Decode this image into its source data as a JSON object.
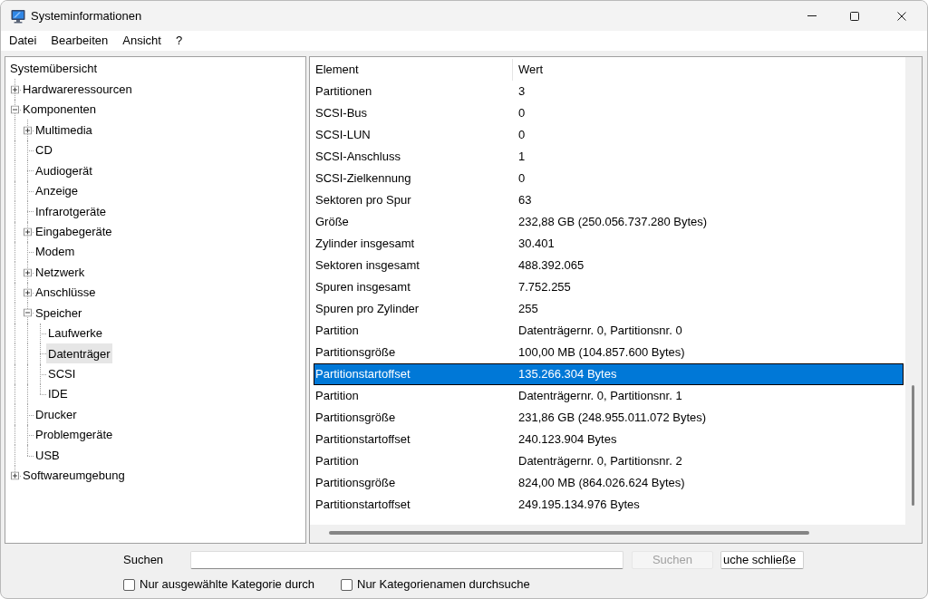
{
  "window": {
    "title": "Systeminformationen"
  },
  "menu": [
    "Datei",
    "Bearbeiten",
    "Ansicht",
    "?"
  ],
  "tree": {
    "items": [
      {
        "label": "Systemübersicht",
        "kind": "root",
        "selected": false,
        "children": [
          {
            "label": "Hardwareressourcen",
            "kind": "branch",
            "expanded": false,
            "selected": false
          },
          {
            "label": "Komponenten",
            "kind": "branch",
            "expanded": true,
            "selected": false,
            "children": [
              {
                "label": "Multimedia",
                "kind": "branch",
                "expanded": false,
                "selected": false
              },
              {
                "label": "CD",
                "kind": "leaf",
                "selected": false
              },
              {
                "label": "Audiogerät",
                "kind": "leaf",
                "selected": false
              },
              {
                "label": "Anzeige",
                "kind": "leaf",
                "selected": false
              },
              {
                "label": "Infrarotgeräte",
                "kind": "leaf",
                "selected": false
              },
              {
                "label": "Eingabegeräte",
                "kind": "branch",
                "expanded": false,
                "selected": false
              },
              {
                "label": "Modem",
                "kind": "leaf",
                "selected": false
              },
              {
                "label": "Netzwerk",
                "kind": "branch",
                "expanded": false,
                "selected": false
              },
              {
                "label": "Anschlüsse",
                "kind": "branch",
                "expanded": false,
                "selected": false
              },
              {
                "label": "Speicher",
                "kind": "branch",
                "expanded": true,
                "selected": false,
                "children": [
                  {
                    "label": "Laufwerke",
                    "kind": "leaf",
                    "selected": false
                  },
                  {
                    "label": "Datenträger",
                    "kind": "leaf",
                    "selected": true
                  },
                  {
                    "label": "SCSI",
                    "kind": "leaf",
                    "selected": false
                  },
                  {
                    "label": "IDE",
                    "kind": "leaf",
                    "selected": false
                  }
                ]
              },
              {
                "label": "Drucker",
                "kind": "leaf",
                "selected": false
              },
              {
                "label": "Problemgeräte",
                "kind": "leaf",
                "selected": false
              },
              {
                "label": "USB",
                "kind": "leaf",
                "selected": false
              }
            ]
          },
          {
            "label": "Softwareumgebung",
            "kind": "branch",
            "expanded": false,
            "selected": false
          }
        ]
      }
    ]
  },
  "table": {
    "columns": [
      "Element",
      "Wert"
    ],
    "rows": [
      {
        "cells": [
          "Partitionen",
          "3"
        ],
        "selected": false
      },
      {
        "cells": [
          "SCSI-Bus",
          "0"
        ],
        "selected": false
      },
      {
        "cells": [
          "SCSI-LUN",
          "0"
        ],
        "selected": false
      },
      {
        "cells": [
          "SCSI-Anschluss",
          "1"
        ],
        "selected": false
      },
      {
        "cells": [
          "SCSI-Zielkennung",
          "0"
        ],
        "selected": false
      },
      {
        "cells": [
          "Sektoren pro Spur",
          "63"
        ],
        "selected": false
      },
      {
        "cells": [
          "Größe",
          "232,88 GB (250.056.737.280 Bytes)"
        ],
        "selected": false
      },
      {
        "cells": [
          "Zylinder insgesamt",
          "30.401"
        ],
        "selected": false
      },
      {
        "cells": [
          "Sektoren insgesamt",
          "488.392.065"
        ],
        "selected": false
      },
      {
        "cells": [
          "Spuren insgesamt",
          "7.752.255"
        ],
        "selected": false
      },
      {
        "cells": [
          "Spuren pro Zylinder",
          "255"
        ],
        "selected": false
      },
      {
        "cells": [
          "Partition",
          "Datenträgernr. 0, Partitionsnr. 0"
        ],
        "selected": false
      },
      {
        "cells": [
          "Partitionsgröße",
          "100,00 MB (104.857.600 Bytes)"
        ],
        "selected": false
      },
      {
        "cells": [
          "Partitionstartoffset",
          "135.266.304 Bytes"
        ],
        "selected": true
      },
      {
        "cells": [
          "Partition",
          "Datenträgernr. 0, Partitionsnr. 1"
        ],
        "selected": false
      },
      {
        "cells": [
          "Partitionsgröße",
          "231,86 GB (248.955.011.072 Bytes)"
        ],
        "selected": false
      },
      {
        "cells": [
          "Partitionstartoffset",
          "240.123.904 Bytes"
        ],
        "selected": false
      },
      {
        "cells": [
          "Partition",
          "Datenträgernr. 0, Partitionsnr. 2"
        ],
        "selected": false
      },
      {
        "cells": [
          "Partitionsgröße",
          "824,00 MB (864.026.624 Bytes)"
        ],
        "selected": false
      },
      {
        "cells": [
          "Partitionstartoffset",
          "249.195.134.976 Bytes"
        ],
        "selected": false
      }
    ]
  },
  "search": {
    "label": "Suchen",
    "buttons": [
      {
        "label": "Suchen",
        "disabled": true
      },
      {
        "label": "uche schließe",
        "disabled": false
      }
    ],
    "options": [
      {
        "label": "Nur ausgewählte Kategorie durch",
        "checked": false
      },
      {
        "label": "Nur Kategorienamen durchsuche",
        "checked": false
      }
    ]
  }
}
